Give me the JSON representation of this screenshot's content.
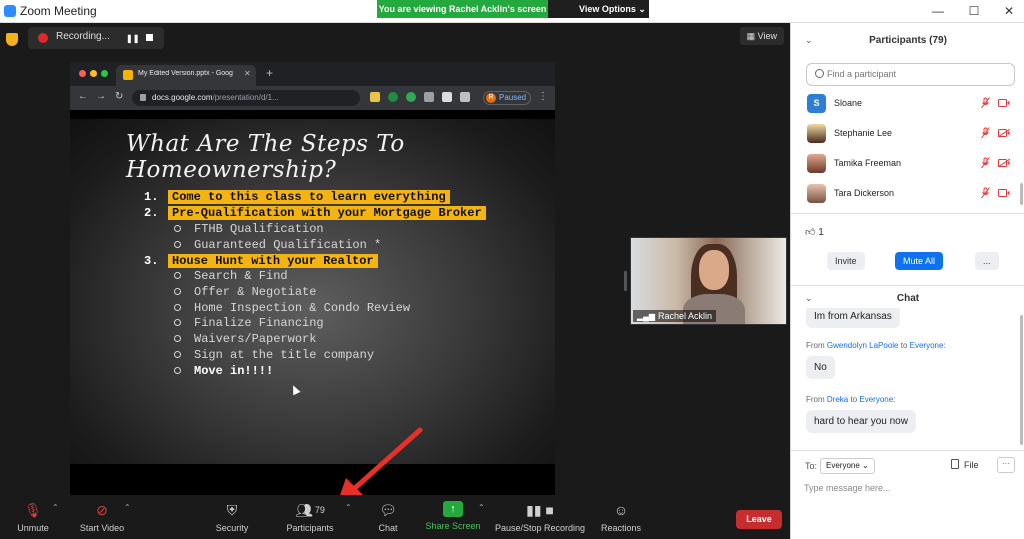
{
  "window": {
    "title": "Zoom Meeting",
    "viewing_banner": "You are viewing Rachel Acklin's screen",
    "view_options": "View Options",
    "controls": {
      "minimize": "—",
      "maximize": "☐",
      "close": "✕"
    }
  },
  "meeting": {
    "recording_label": "Recording...",
    "view_label": "View"
  },
  "browser": {
    "tab_title": "My Edited Version.pptx - Goog",
    "url_host": "docs.google.com",
    "url_path": "/presentation/d/1...",
    "paused_label": "Paused",
    "avatar_letter": "R"
  },
  "slide": {
    "title": "What Are The Steps To Homeownership?",
    "items": [
      {
        "num": "1.",
        "text": "Come to this class to learn everything"
      },
      {
        "num": "2.",
        "text": "Pre-Qualification with your Mortgage Broker"
      },
      {
        "num": "3.",
        "text": "House Hunt with your Realtor"
      }
    ],
    "sub_items_2": [
      "FTHB Qualification",
      "Guaranteed Qualification *"
    ],
    "sub_items_3": [
      "Search & Find",
      "Offer & Negotiate",
      "Home Inspection & Condo Review",
      "Finalize Financing",
      "Waivers/Paperwork",
      "Sign at the title company",
      "Move in!!!!"
    ]
  },
  "video": {
    "name": "Rachel Acklin"
  },
  "toolbar": {
    "unmute": "Unmute",
    "start_video": "Start Video",
    "security": "Security",
    "participants": "Participants",
    "participants_count": "79",
    "chat": "Chat",
    "share_screen": "Share Screen",
    "record": "Pause/Stop Recording",
    "reactions": "Reactions",
    "leave": "Leave"
  },
  "participants_panel": {
    "title": "Participants (79)",
    "search_placeholder": "Find a participant",
    "people": [
      {
        "name": "Sloane",
        "initial": "S"
      },
      {
        "name": "Stephanie Lee"
      },
      {
        "name": "Tamika Freeman"
      },
      {
        "name": "Tara Dickerson"
      }
    ],
    "thumbs_count": "1",
    "invite": "Invite",
    "mute_all": "Mute All",
    "more": "..."
  },
  "chat": {
    "title": "Chat",
    "messages": [
      {
        "text": "Im from Arkansas"
      },
      {
        "from": "Gwendolyn LaPoole",
        "to_word": "to",
        "to": "Everyone:",
        "text": "No"
      },
      {
        "from": "Dreka",
        "to_word": "to",
        "to": "Everyone:",
        "text": "hard to hear you now"
      }
    ],
    "to_label": "To:",
    "to_value": "Everyone",
    "file_label": "File",
    "more": "···",
    "input_placeholder": "Type message here..."
  },
  "colors": {
    "accent_blue": "#0e72ed",
    "share_green": "#23a93d",
    "leave_red": "#c62d2d",
    "slide_highlight": "#f3b413"
  }
}
